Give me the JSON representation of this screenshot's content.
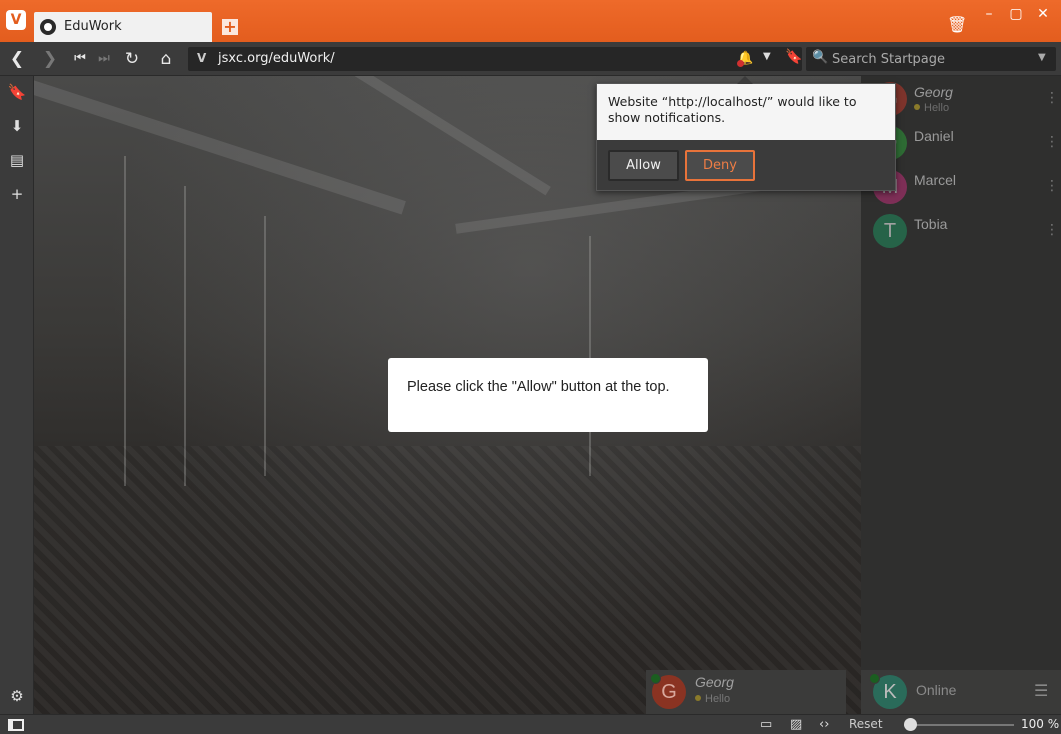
{
  "browser": {
    "tab_title": "EduWork",
    "url": "jsxc.org/eduWork/",
    "search_placeholder": "Search Startpage",
    "accent_color": "#e35d1e"
  },
  "notification_prompt": {
    "message": "Website “http://localhost/” would like to show notifications.",
    "allow_label": "Allow",
    "deny_label": "Deny"
  },
  "page": {
    "dialog_text": "Please click the \"Allow\" button at the top."
  },
  "roster": {
    "contacts": [
      {
        "initial": "G",
        "name": "Georg",
        "status": "Hello",
        "color": "#c0392b"
      },
      {
        "initial": "D",
        "name": "Daniel",
        "status": "",
        "color": "#2e9d3a"
      },
      {
        "initial": "M",
        "name": "Marcel",
        "status": "",
        "color": "#c0307a"
      },
      {
        "initial": "T",
        "name": "Tobia",
        "status": "",
        "color": "#1f8f5f"
      }
    ],
    "me_initial": "K",
    "presence": "Online"
  },
  "chat_window": {
    "initial": "G",
    "name": "Georg",
    "status": "Hello"
  },
  "statusbar": {
    "reset_label": "Reset",
    "zoom": "100 %"
  },
  "icons": [
    "vivaldi-logo-icon",
    "tab-favicon-icon",
    "new-tab-icon",
    "trash-icon",
    "minimize-icon",
    "maximize-icon",
    "close-icon",
    "back-icon",
    "forward-icon",
    "rewind-icon",
    "fast-forward-icon",
    "reload-icon",
    "home-icon",
    "notification-bell-icon",
    "bookmark-icon",
    "search-icon",
    "downloads-icon",
    "notes-icon",
    "add-panel-icon",
    "settings-icon",
    "panel-toggle-icon",
    "page-tiling-icon",
    "image-icon",
    "code-icon",
    "contact-menu-icon",
    "roster-menu-icon"
  ]
}
